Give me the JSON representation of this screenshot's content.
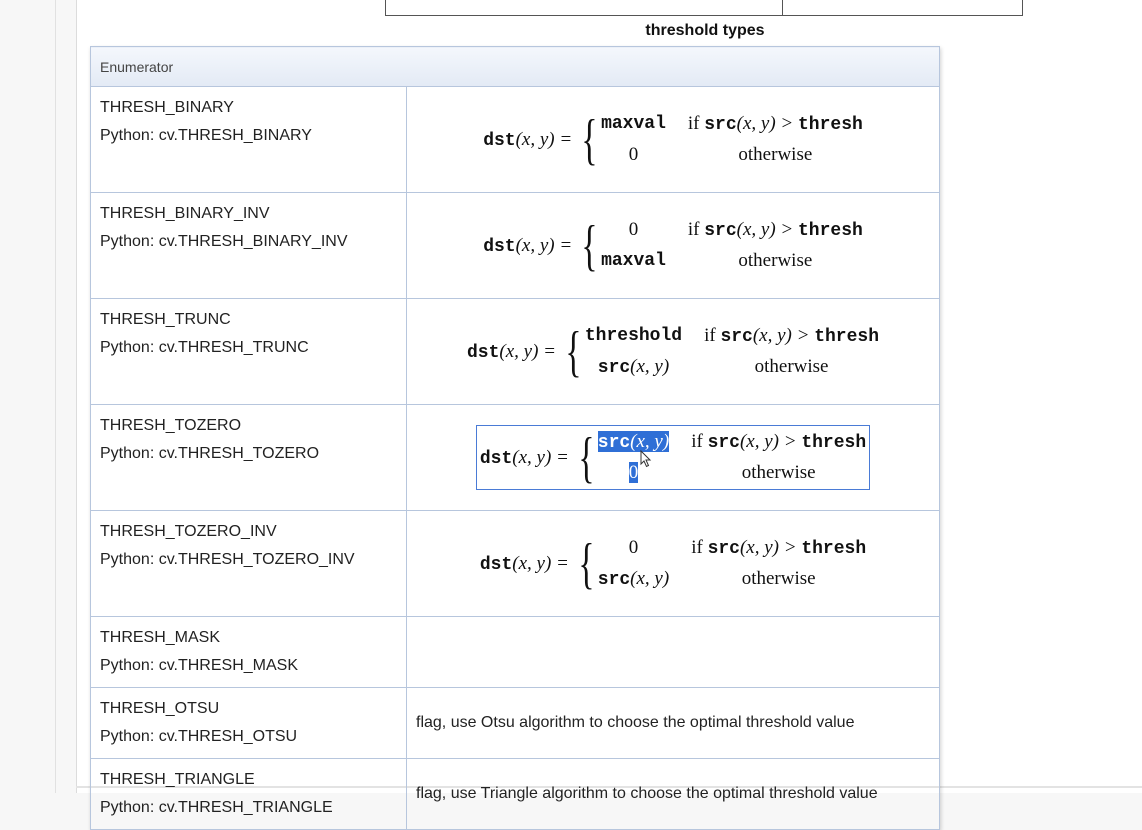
{
  "caption": "threshold types",
  "table": {
    "header": "Enumerator",
    "rows": [
      {
        "name": "THRESH_BINARY",
        "python": "Python: cv.THRESH_BINARY",
        "formula": {
          "lhs_fn": "dst",
          "args": "(x, y) =",
          "rows": [
            {
              "value": "maxval",
              "cond_text": "if",
              "cond_fn": "src",
              "cond_args": "(x, y) >",
              "cond_var": "thresh"
            },
            {
              "value": "0",
              "cond_text": "otherwise"
            }
          ]
        }
      },
      {
        "name": "THRESH_BINARY_INV",
        "python": "Python: cv.THRESH_BINARY_INV",
        "formula": {
          "lhs_fn": "dst",
          "args": "(x, y) =",
          "rows": [
            {
              "value": "0",
              "cond_text": "if",
              "cond_fn": "src",
              "cond_args": "(x, y) >",
              "cond_var": "thresh"
            },
            {
              "value": "maxval",
              "cond_text": "otherwise"
            }
          ]
        }
      },
      {
        "name": "THRESH_TRUNC",
        "python": "Python: cv.THRESH_TRUNC",
        "formula": {
          "lhs_fn": "dst",
          "args": "(x, y) =",
          "rows": [
            {
              "value": "threshold",
              "cond_text": "if",
              "cond_fn": "src",
              "cond_args": "(x, y) >",
              "cond_var": "thresh"
            },
            {
              "value_fn": "src",
              "value_args": "(x, y)",
              "cond_text": "otherwise"
            }
          ]
        }
      },
      {
        "name": "THRESH_TOZERO",
        "python": "Python: cv.THRESH_TOZERO",
        "formula": {
          "lhs_fn": "dst",
          "args": "(x, y) =",
          "rows": [
            {
              "value_fn": "src",
              "value_args": "(x, y)",
              "cond_text": "if",
              "cond_fn": "src",
              "cond_args": "(x, y) >",
              "cond_var": "thresh"
            },
            {
              "value": "0",
              "cond_text": "otherwise"
            }
          ]
        }
      },
      {
        "name": "THRESH_TOZERO_INV",
        "python": "Python: cv.THRESH_TOZERO_INV",
        "formula": {
          "lhs_fn": "dst",
          "args": "(x, y) =",
          "rows": [
            {
              "value": "0",
              "cond_text": "if",
              "cond_fn": "src",
              "cond_args": "(x, y) >",
              "cond_var": "thresh"
            },
            {
              "value_fn": "src",
              "value_args": "(x, y)",
              "cond_text": "otherwise"
            }
          ]
        }
      },
      {
        "name": "THRESH_MASK",
        "python": "Python: cv.THRESH_MASK",
        "description": ""
      },
      {
        "name": "THRESH_OTSU",
        "python": "Python: cv.THRESH_OTSU",
        "description": "flag, use Otsu algorithm to choose the optimal threshold value"
      },
      {
        "name": "THRESH_TRIANGLE",
        "python": "Python: cv.THRESH_TRIANGLE",
        "description": "flag, use Triangle algorithm to choose the optimal threshold value"
      }
    ]
  },
  "selection_color": "#2f6fd6"
}
